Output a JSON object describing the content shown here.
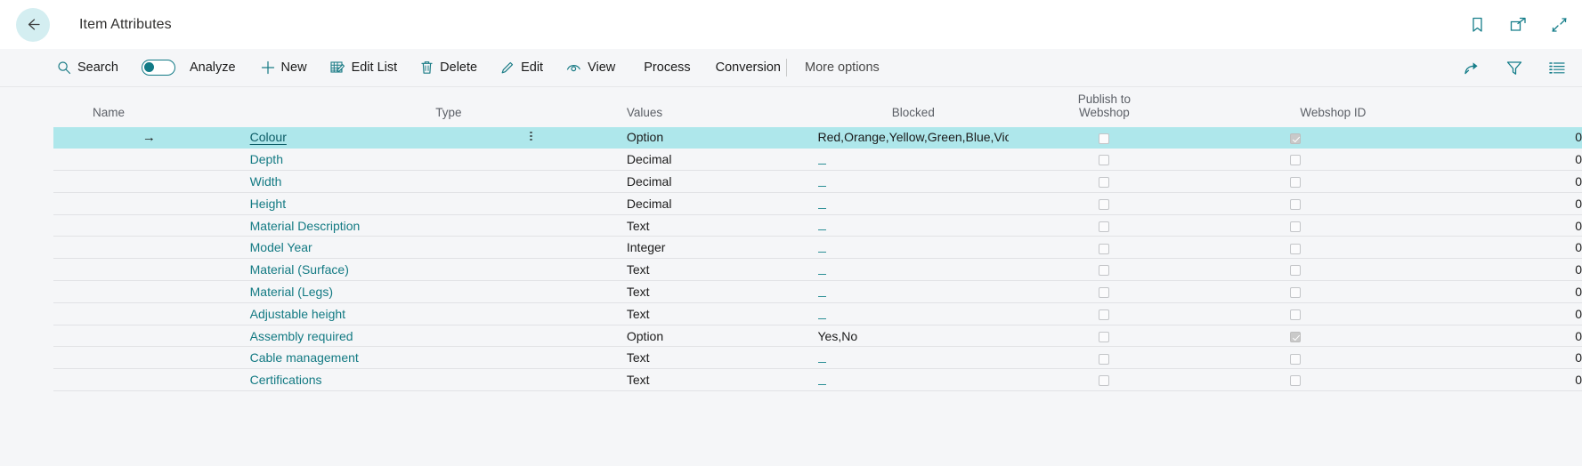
{
  "header": {
    "back_icon": "arrow-left-icon",
    "title": "Item Attributes",
    "actions": [
      {
        "name": "bookmark-icon",
        "label": "Bookmark"
      },
      {
        "name": "open-in-new-window-icon",
        "label": "Open in new window"
      },
      {
        "name": "collapse-icon",
        "label": "Collapse"
      }
    ]
  },
  "toolbar": {
    "search_label": "Search",
    "analyze_label": "Analyze",
    "analyze_toggle_on": false,
    "new_label": "New",
    "edit_list_label": "Edit List",
    "delete_label": "Delete",
    "edit_label": "Edit",
    "view_label": "View",
    "process_label": "Process",
    "conversion_label": "Conversion",
    "more_options_label": "More options",
    "right_icons": [
      {
        "name": "share-icon",
        "label": "Share"
      },
      {
        "name": "filter-icon",
        "label": "Filter"
      },
      {
        "name": "list-view-icon",
        "label": "Choose columns"
      }
    ]
  },
  "table": {
    "columns": {
      "name": "Name",
      "type": "Type",
      "values": "Values",
      "blocked": "Blocked",
      "publish_line1": "Publish to",
      "publish_line2": "Webshop",
      "webshop_id": "Webshop ID"
    },
    "empty_value_glyph": "_",
    "rows": [
      {
        "selected": true,
        "arrow": "→",
        "name": "Colour",
        "type": "Option",
        "values": "Red,Orange,Yellow,Green,Blue,Violet,Purple,Black,White,",
        "values_empty": false,
        "blocked": false,
        "publish": true,
        "webshop_id": "0"
      },
      {
        "selected": false,
        "arrow": "",
        "name": "Depth",
        "type": "Decimal",
        "values": "",
        "values_empty": true,
        "blocked": false,
        "publish": false,
        "webshop_id": "0"
      },
      {
        "selected": false,
        "arrow": "",
        "name": "Width",
        "type": "Decimal",
        "values": "",
        "values_empty": true,
        "blocked": false,
        "publish": false,
        "webshop_id": "0"
      },
      {
        "selected": false,
        "arrow": "",
        "name": "Height",
        "type": "Decimal",
        "values": "",
        "values_empty": true,
        "blocked": false,
        "publish": false,
        "webshop_id": "0"
      },
      {
        "selected": false,
        "arrow": "",
        "name": "Material Description",
        "type": "Text",
        "values": "",
        "values_empty": true,
        "blocked": false,
        "publish": false,
        "webshop_id": "0"
      },
      {
        "selected": false,
        "arrow": "",
        "name": "Model Year",
        "type": "Integer",
        "values": "",
        "values_empty": true,
        "blocked": false,
        "publish": false,
        "webshop_id": "0"
      },
      {
        "selected": false,
        "arrow": "",
        "name": "Material (Surface)",
        "type": "Text",
        "values": "",
        "values_empty": true,
        "blocked": false,
        "publish": false,
        "webshop_id": "0"
      },
      {
        "selected": false,
        "arrow": "",
        "name": "Material (Legs)",
        "type": "Text",
        "values": "",
        "values_empty": true,
        "blocked": false,
        "publish": false,
        "webshop_id": "0"
      },
      {
        "selected": false,
        "arrow": "",
        "name": "Adjustable height",
        "type": "Text",
        "values": "",
        "values_empty": true,
        "blocked": false,
        "publish": false,
        "webshop_id": "0"
      },
      {
        "selected": false,
        "arrow": "",
        "name": "Assembly required",
        "type": "Option",
        "values": "Yes,No",
        "values_empty": false,
        "blocked": false,
        "publish": true,
        "webshop_id": "0"
      },
      {
        "selected": false,
        "arrow": "",
        "name": "Cable management",
        "type": "Text",
        "values": "",
        "values_empty": true,
        "blocked": false,
        "publish": false,
        "webshop_id": "0"
      },
      {
        "selected": false,
        "arrow": "",
        "name": "Certifications",
        "type": "Text",
        "values": "",
        "values_empty": true,
        "blocked": false,
        "publish": false,
        "webshop_id": "0"
      }
    ]
  },
  "colors": {
    "accent": "#137a83",
    "selection": "#aee7eb",
    "page_bg": "#f5f6f8",
    "back_circle": "#d4eef1"
  }
}
